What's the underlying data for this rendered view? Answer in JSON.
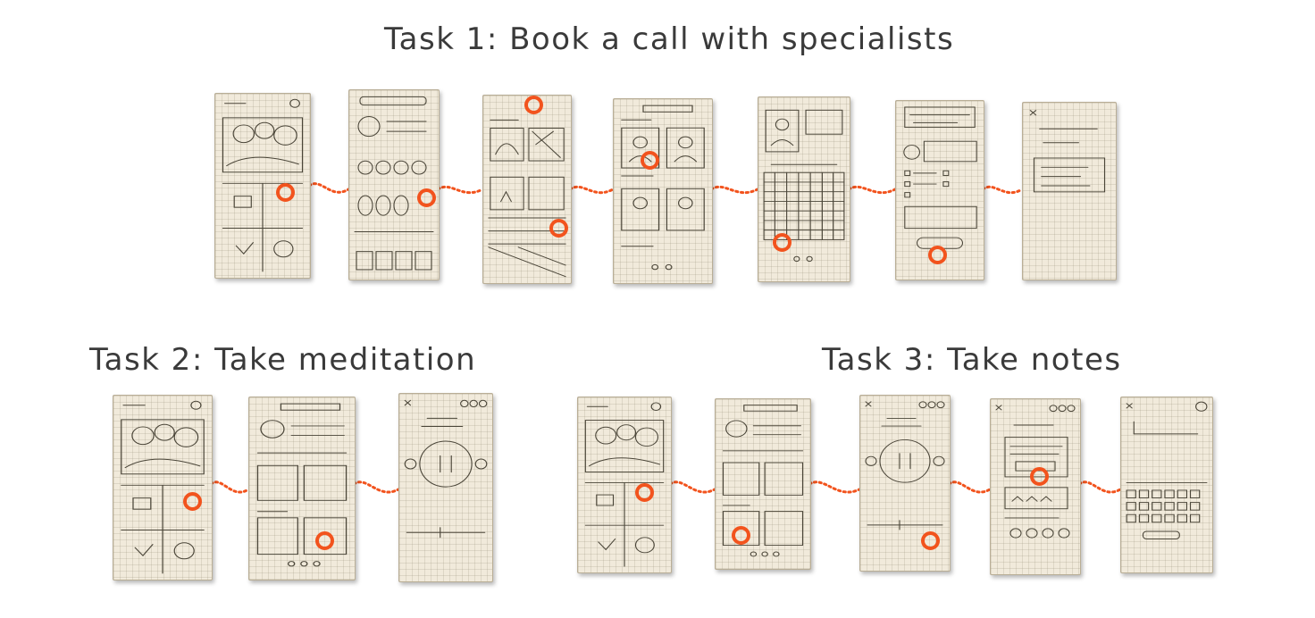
{
  "tasks": [
    {
      "title": "Task 1: Book a call with specialists",
      "screens": 7
    },
    {
      "title": "Task 2: Take meditation",
      "screens": 3
    },
    {
      "title": "Task 3: Take notes",
      "screens": 5
    }
  ],
  "colors": {
    "paper": "#f1eadb",
    "grid": "#c8bfa9",
    "pencil": "#4a4538",
    "tap_marker": "#f2531d",
    "background": "#ffffff"
  },
  "icons": [
    "tap-indicator-icon",
    "flow-connector-icon",
    "play-pause-icon"
  ]
}
